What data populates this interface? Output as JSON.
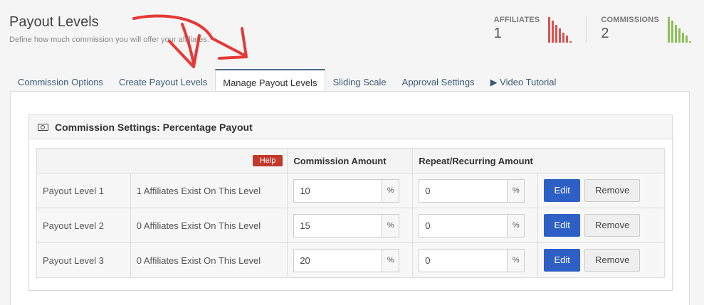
{
  "page": {
    "title": "Payout Levels",
    "subtitle": "Define how much commission you will offer your affiliates."
  },
  "stats": {
    "affiliates": {
      "label": "AFFILIATES",
      "value": "1",
      "color": "#d9534f",
      "bars": [
        1.0,
        0.85,
        0.7,
        0.55,
        0.4,
        0.28,
        0.05
      ]
    },
    "commissions": {
      "label": "COMMISSIONS",
      "value": "2",
      "color": "#8cbf5a",
      "bars": [
        1.0,
        0.85,
        0.7,
        0.55,
        0.4,
        0.28,
        0.05
      ]
    }
  },
  "tabs": [
    {
      "label": "Commission Options"
    },
    {
      "label": "Create Payout Levels"
    },
    {
      "label": "Manage Payout Levels",
      "active": true
    },
    {
      "label": "Sliding Scale"
    },
    {
      "label": "Approval Settings"
    },
    {
      "label": "▶ Video Tutorial"
    }
  ],
  "panel": {
    "title": "Commission Settings: Percentage Payout",
    "help_label": "Help",
    "columns": [
      "Commission Amount",
      "Repeat/Recurring Amount"
    ],
    "suffix": "%",
    "edit_label": "Edit",
    "remove_label": "Remove",
    "rows": [
      {
        "name": "Payout Level 1",
        "info": "1 Affiliates Exist On This Level",
        "commission": "10",
        "recurring": "0"
      },
      {
        "name": "Payout Level 2",
        "info": "0 Affiliates Exist On This Level",
        "commission": "15",
        "recurring": "0"
      },
      {
        "name": "Payout Level 3",
        "info": "0 Affiliates Exist On This Level",
        "commission": "20",
        "recurring": "0"
      }
    ]
  },
  "colors": {
    "accent": "#2d5fc4",
    "help": "#c0392b",
    "arrow": "#e53935"
  }
}
